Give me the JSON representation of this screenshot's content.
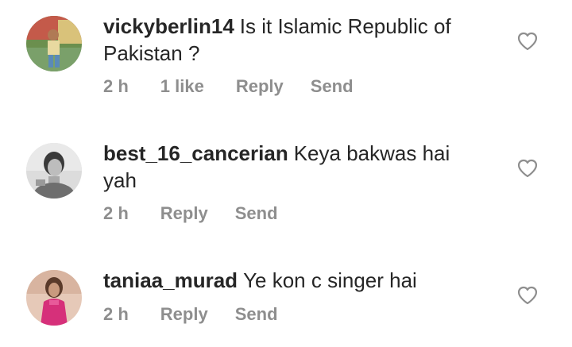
{
  "comments": [
    {
      "username": "vickyberlin14",
      "text": "Is it Islamic Republic of Pakistan ?",
      "time": "2 h",
      "likes": "1 like",
      "reply": "Reply",
      "send": "Send"
    },
    {
      "username": "best_16_cancerian",
      "text": "Keya bakwas hai yah",
      "time": "2 h",
      "reply": "Reply",
      "send": "Send"
    },
    {
      "username": "taniaa_murad",
      "text": "Ye kon c singer hai",
      "time": "2 h",
      "reply": "Reply",
      "send": "Send"
    }
  ],
  "colors": {
    "text": "#262626",
    "meta": "#8e8e8e",
    "heart_outline": "#8e8e8e"
  }
}
